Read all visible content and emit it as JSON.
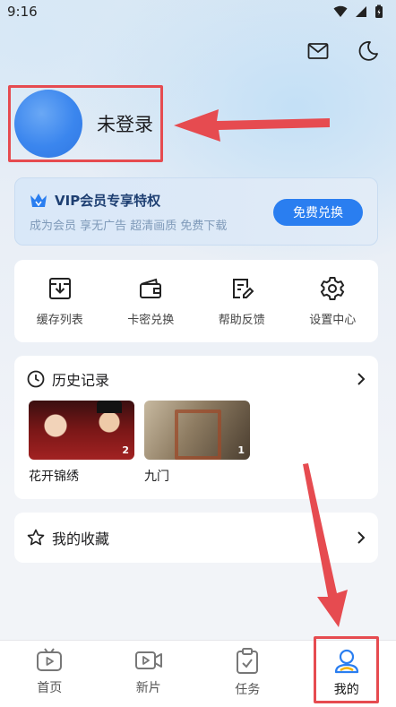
{
  "status": {
    "time": "9:16"
  },
  "profile": {
    "login_text": "未登录"
  },
  "vip": {
    "title": "VIP会员专享特权",
    "subtitle": "成为会员 享无广告 超清画质 免费下载",
    "button": "免费兑换"
  },
  "tools": [
    {
      "label": "缓存列表",
      "icon": "download-box-icon"
    },
    {
      "label": "卡密兑换",
      "icon": "wallet-icon"
    },
    {
      "label": "帮助反馈",
      "icon": "edit-note-icon"
    },
    {
      "label": "设置中心",
      "icon": "gear-icon"
    }
  ],
  "history": {
    "title": "历史记录",
    "items": [
      {
        "title": "花开锦绣",
        "badge": "2"
      },
      {
        "title": "九门",
        "badge": "1"
      }
    ]
  },
  "favorites": {
    "title": "我的收藏"
  },
  "tabbar": {
    "tabs": [
      {
        "label": "首页",
        "icon": "tv-icon"
      },
      {
        "label": "新片",
        "icon": "video-camera-icon"
      },
      {
        "label": "任务",
        "icon": "clipboard-check-icon"
      },
      {
        "label": "我的",
        "icon": "user-icon"
      }
    ],
    "active_index": 3
  },
  "colors": {
    "accent": "#2a7ef0",
    "annotation": "#e64b50"
  }
}
